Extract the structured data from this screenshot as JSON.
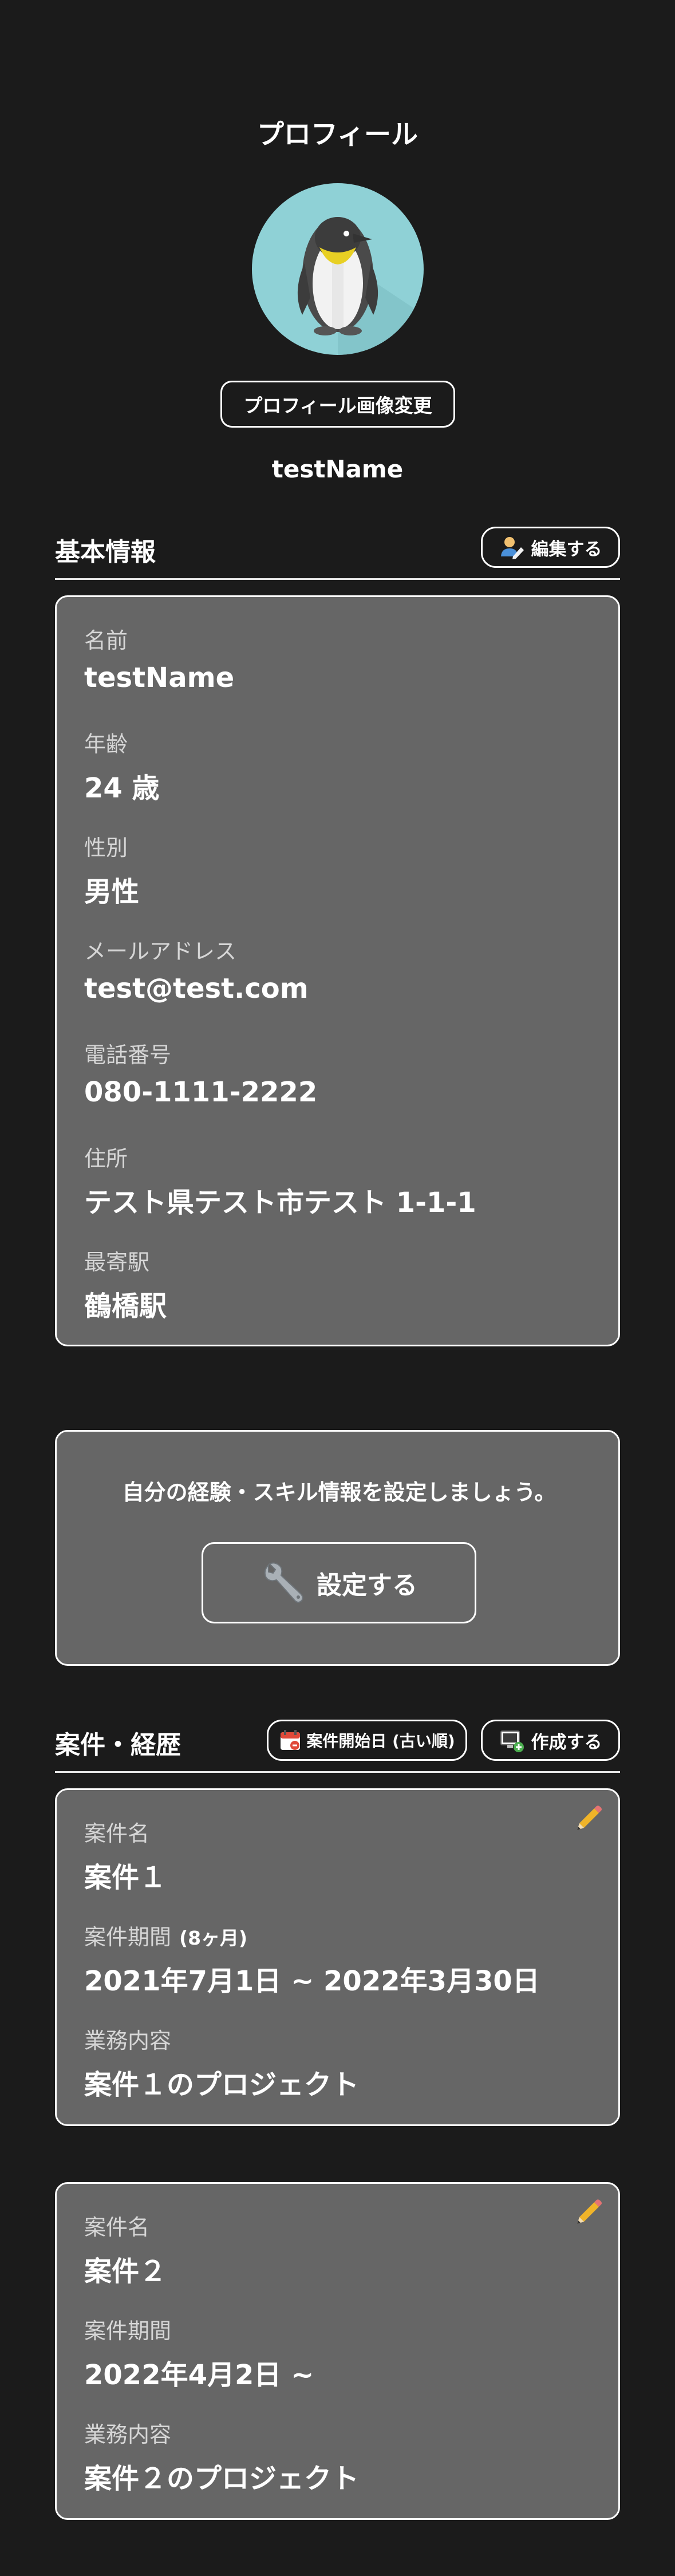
{
  "header": {
    "title": "プロフィール"
  },
  "profile": {
    "change_image_label": "プロフィール画像変更",
    "display_name": "testName"
  },
  "basic_info": {
    "title": "基本情報",
    "edit_label": "編集する",
    "fields": [
      {
        "label": "名前",
        "value": "testName"
      },
      {
        "label": "年齢",
        "value": "24 歳"
      },
      {
        "label": "性別",
        "value": "男性"
      },
      {
        "label": "メールアドレス",
        "value": "test@test.com"
      },
      {
        "label": "電話番号",
        "value": "080-1111-2222"
      },
      {
        "label": "住所",
        "value": "テスト県テスト市テスト 1-1-1"
      },
      {
        "label": "最寄駅",
        "value": "鶴橋駅"
      }
    ]
  },
  "skill": {
    "message": "自分の経験・スキル情報を設定しましょう。",
    "button_label": "設定する"
  },
  "projects": {
    "title": "案件・経歴",
    "sort_label": "案件開始日 (古い順)",
    "create_label": "作成する",
    "items": [
      {
        "name_label": "案件名",
        "name": "案件１",
        "period_label": "案件期間",
        "period_sub": "(8ヶ月)",
        "period": "2021年7月1日 ~ 2022年3月30日",
        "desc_label": "業務内容",
        "desc": "案件１のプロジェクト"
      },
      {
        "name_label": "案件名",
        "name": "案件２",
        "period_label": "案件期間",
        "period": "2022年4月2日 ~",
        "desc_label": "業務内容",
        "desc": "案件２のプロジェクト"
      }
    ]
  },
  "icons": {
    "avatar": "penguin-avatar",
    "edit": "person-edit-icon",
    "wrench": "wrench-icon",
    "calendar": "calendar-icon",
    "create": "monitor-add-icon",
    "pencil": "pencil-icon"
  },
  "colors": {
    "background": "#1b1b1b",
    "card": "#666666",
    "avatar_bg": "#8fd1d6"
  }
}
